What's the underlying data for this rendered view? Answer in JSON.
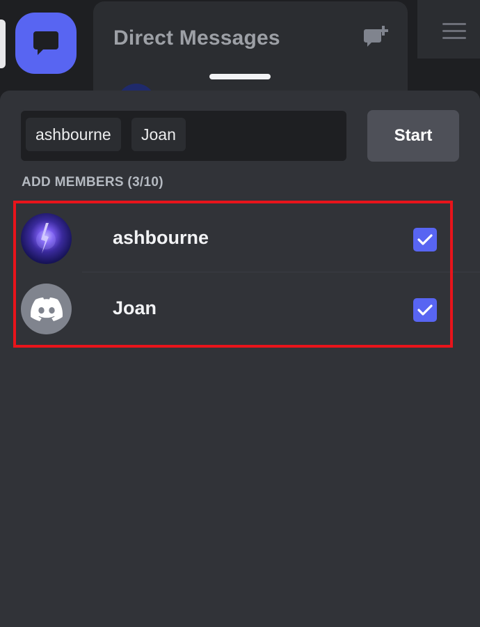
{
  "header": {
    "title": "Direct Messages"
  },
  "sheet": {
    "search_chips": [
      "ashbourne",
      "Joan"
    ],
    "start_label": "Start",
    "section_title": "ADD MEMBERS (3/10)",
    "members": [
      {
        "name": "ashbourne",
        "checked": true,
        "avatar": "storm-image"
      },
      {
        "name": "Joan",
        "checked": true,
        "avatar": "discord-default-icon"
      }
    ]
  },
  "icons": {
    "dm_home": "chat-bubble-icon",
    "new_dm": "new-group-dm-icon",
    "menu": "hamburger-menu-icon",
    "check": "checkmark-icon"
  },
  "colors": {
    "accent": "#5865f2",
    "sheet_bg": "#313338",
    "highlight": "#e8141b"
  }
}
